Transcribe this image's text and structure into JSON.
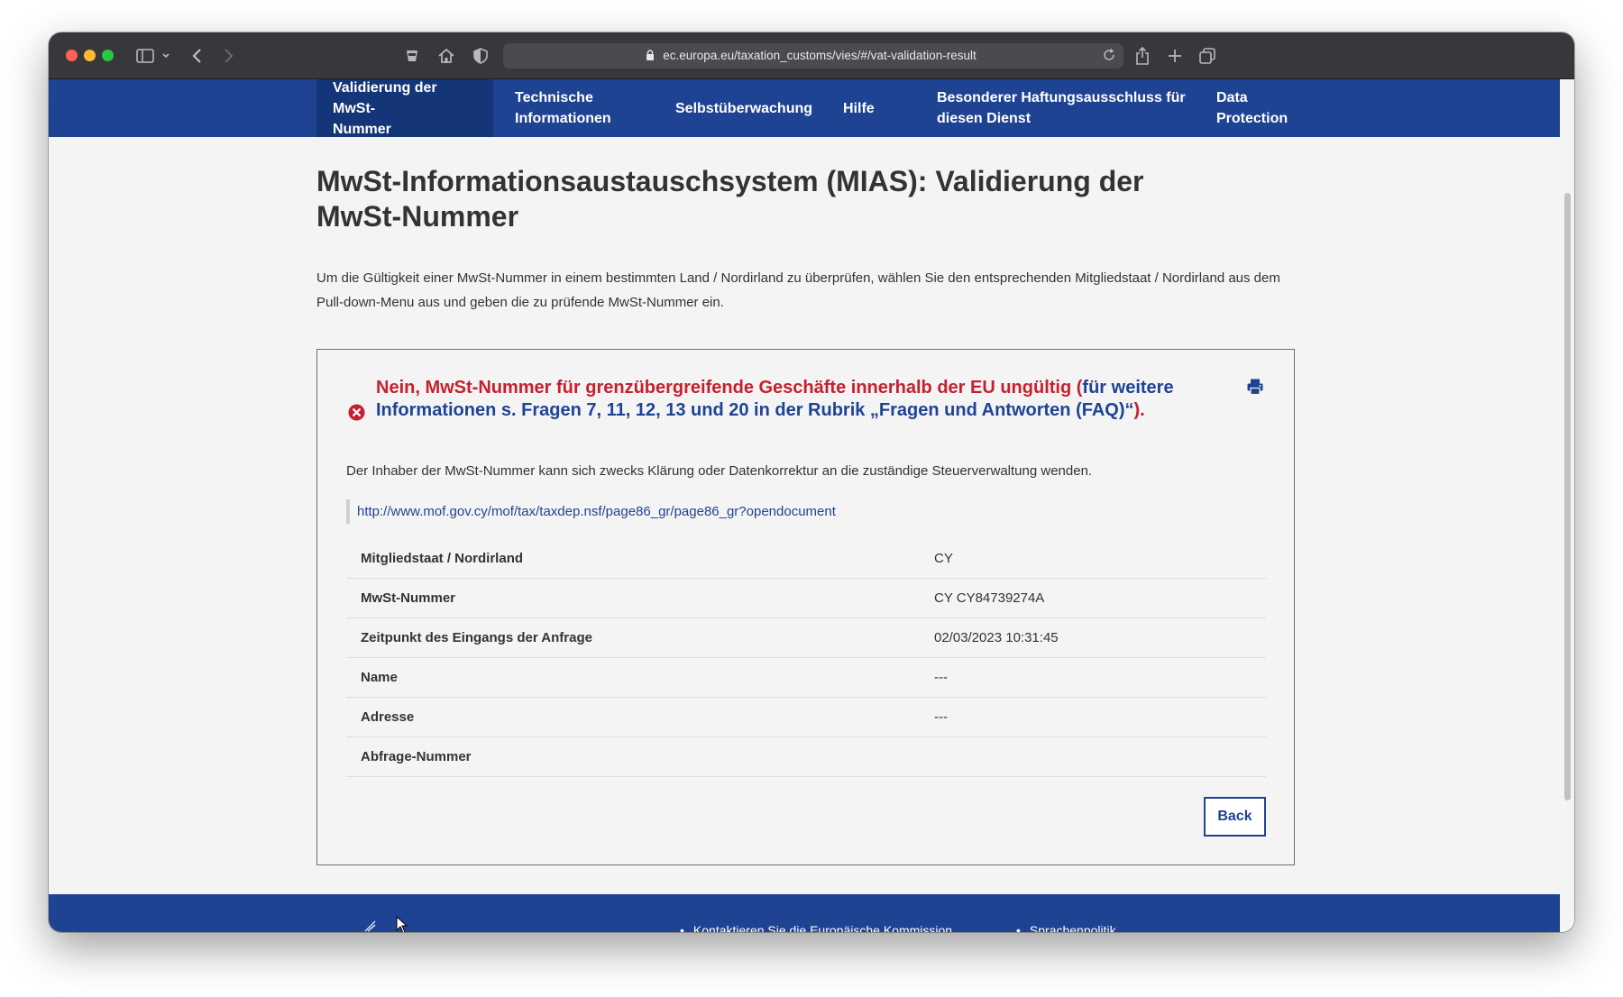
{
  "browser": {
    "url": "ec.europa.eu/taxation_customs/vies/#/vat-validation-result"
  },
  "nav": {
    "items": [
      {
        "line1": "Validierung der MwSt-",
        "line2": "Nummer"
      },
      {
        "line1": "Technische",
        "line2": "Informationen"
      },
      {
        "line1": "Selbstüberwachung",
        "line2": ""
      },
      {
        "line1": "Hilfe",
        "line2": ""
      },
      {
        "line1": "Besonderer Haftungsausschluss für",
        "line2": "diesen Dienst"
      },
      {
        "line1": "Data",
        "line2": "Protection"
      }
    ]
  },
  "page": {
    "title": "MwSt-Informationsaustauschsystem (MIAS): Validierung der MwSt-Nummer",
    "intro": "Um die Gültigkeit einer MwSt-Nummer in einem bestimmten Land / Nordirland zu überprüfen, wählen Sie den entsprechenden Mitgliedstaat / Nordirland aus dem Pull-down-Menu aus und geben die zu prüfende MwSt-Nummer ein."
  },
  "result": {
    "error_prefix": "Nein, MwSt-Nummer für grenzübergreifende Geschäfte innerhalb der EU ungültig (",
    "error_link": "für weitere Informationen s. Fragen 7, 11, 12, 13 und 20 in der Rubrik „Fragen und Antworten (FAQ)“",
    "error_suffix": ").",
    "note": "Der Inhaber der MwSt-Nummer kann sich zwecks Klärung oder Datenkorrektur an die zuständige Steuerverwaltung wenden.",
    "link": "http://www.mof.gov.cy/mof/tax/taxdep.nsf/page86_gr/page86_gr?opendocument",
    "rows": [
      {
        "label": "Mitgliedstaat / Nordirland",
        "value": "CY"
      },
      {
        "label": "MwSt-Nummer",
        "value": "CY CY84739274A"
      },
      {
        "label": "Zeitpunkt des Eingangs der Anfrage",
        "value": "02/03/2023 10:31:45"
      },
      {
        "label": "Name",
        "value": "---"
      },
      {
        "label": "Adresse",
        "value": "---"
      },
      {
        "label": "Abfrage-Nummer",
        "value": ""
      }
    ],
    "back_label": "Back"
  },
  "footer": {
    "links": [
      "Kontaktieren Sie die Europäische Kommission",
      "Sprachenpolitik"
    ]
  },
  "colors": {
    "nav_bg": "#1f4393",
    "nav_active": "#143577",
    "error_red": "#c5202f",
    "link_blue": "#1f4393"
  }
}
